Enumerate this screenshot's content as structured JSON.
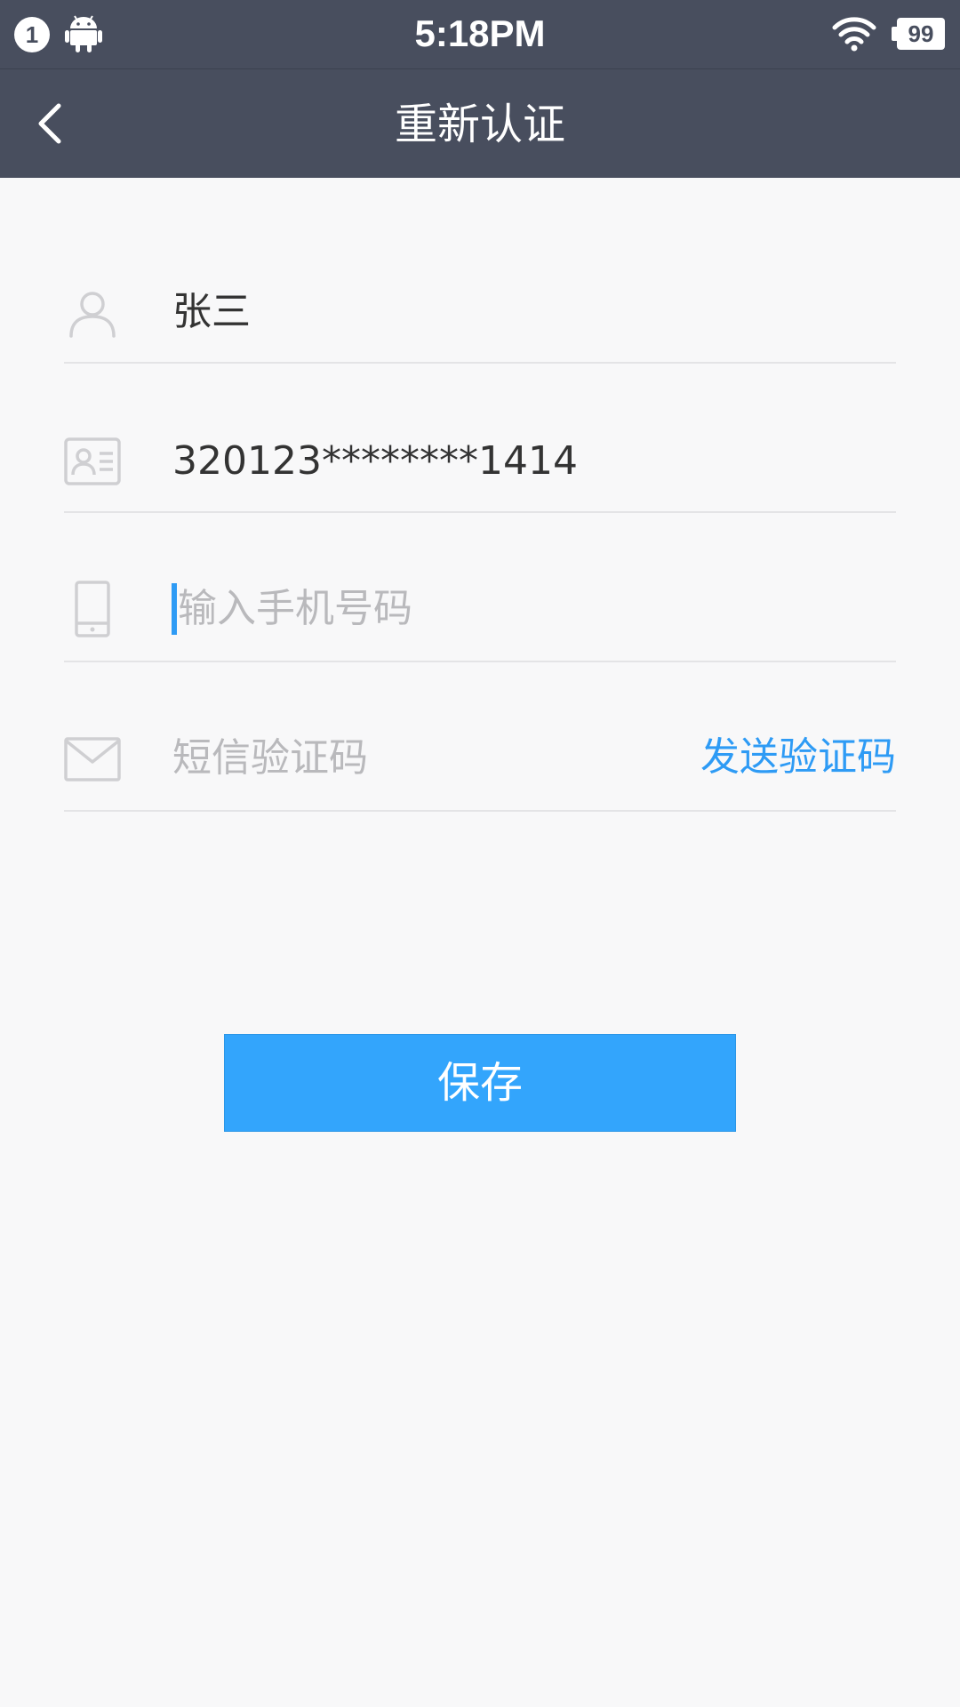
{
  "status_bar": {
    "notification_count": "1",
    "time": "5:18PM",
    "battery": "99",
    "icons": [
      "android-icon",
      "wifi-icon",
      "battery-icon"
    ]
  },
  "nav": {
    "title": "重新认证",
    "back_icon": "chevron-left-icon"
  },
  "form": {
    "name": {
      "icon": "person-icon",
      "value": "张三"
    },
    "id_card": {
      "icon": "id-card-icon",
      "value": "320123********1414"
    },
    "phone": {
      "icon": "mobile-phone-icon",
      "value": "",
      "placeholder": "输入手机号码"
    },
    "sms_code": {
      "icon": "envelope-icon",
      "value": "",
      "placeholder": "短信验证码",
      "send_label": "发送验证码"
    }
  },
  "save_label": "保存",
  "colors": {
    "header_bg": "#484e5e",
    "accent": "#2e9bf5",
    "button_bg": "#33a5fc",
    "page_bg": "#f8f8f9",
    "placeholder": "#b9b9bc",
    "divider": "#e4e4e6"
  }
}
